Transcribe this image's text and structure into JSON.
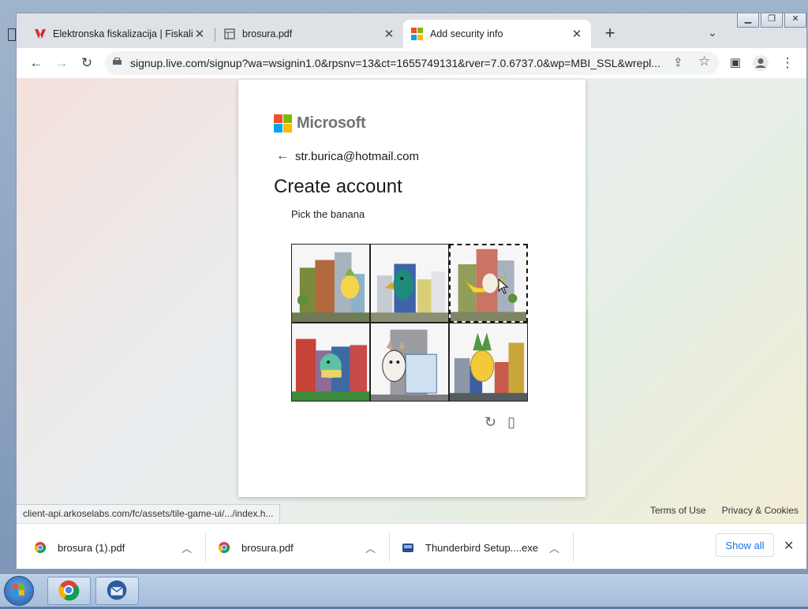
{
  "tabs": [
    {
      "title": "Elektronska fiskalizacija | Fiskaliza",
      "favicon": "fiskalizacija-logo-icon"
    },
    {
      "title": "brosura.pdf",
      "favicon": "pdf-doc-icon"
    },
    {
      "title": "Add security info",
      "favicon": "microsoft-logo-icon"
    }
  ],
  "toolbar": {
    "url": "signup.live.com/signup?wa=wsignin1.0&rpsnv=13&ct=1655749131&rver=7.0.6737.0&wp=MBI_SSL&wrepl..."
  },
  "page": {
    "brand": "Microsoft",
    "email": "str.burica@hotmail.com",
    "title": "Create account",
    "prompt": "Pick the banana",
    "tiles": [
      "pineapple",
      "duck",
      "banana",
      "dinosaur",
      "goat",
      "pineapple"
    ],
    "selected_tile": 2
  },
  "footer": {
    "terms": "Terms of Use",
    "privacy": "Privacy & Cookies"
  },
  "status_url": "client-api.arkoselabs.com/fc/assets/tile-game-ui/.../index.h...",
  "downloads": [
    {
      "name": "brosura (1).pdf"
    },
    {
      "name": "brosura.pdf"
    },
    {
      "name": "Thunderbird Setup....exe"
    }
  ],
  "downloads_show_all": "Show all",
  "colors": {
    "ms_red": "#f25022",
    "ms_green": "#7fba00",
    "ms_blue": "#00a4ef",
    "ms_yellow": "#ffb900"
  }
}
